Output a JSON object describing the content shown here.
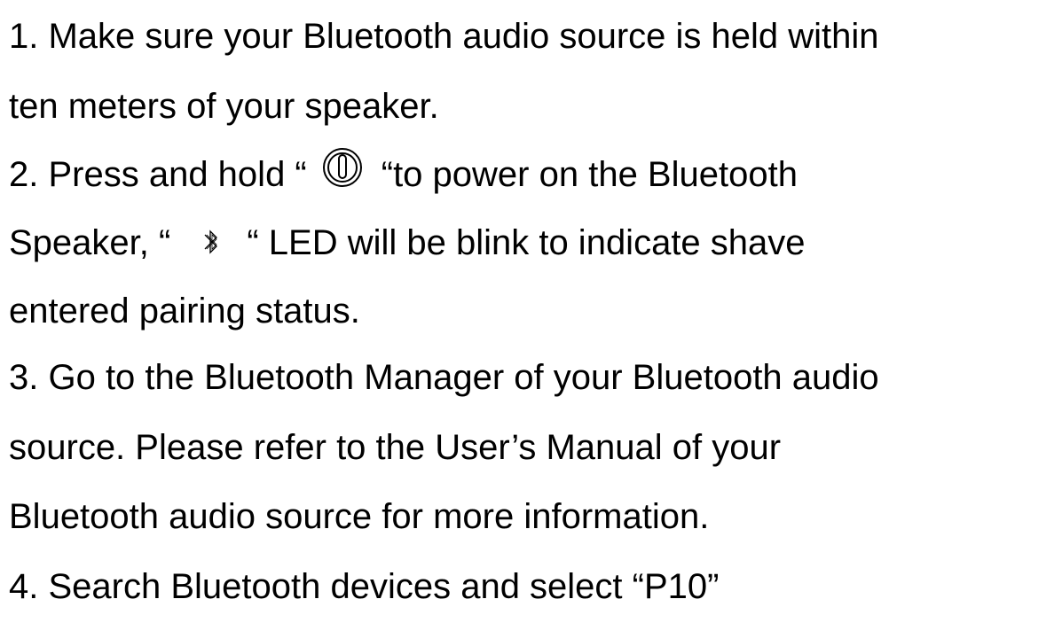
{
  "document": {
    "steps": [
      {
        "line1": "1. Make sure your Bluetooth audio source is held within",
        "line2": "ten meters of your speaker."
      },
      {
        "line1_before_icon": "2. Press and hold “",
        "line1_after_icon": "“to power on the Bluetooth",
        "line2_before_icon": "Speaker, “",
        "line2_after_icon": "“ LED will be blink to indicate shave",
        "line3": "entered pairing status.",
        "icons": [
          "power-icon",
          "bluetooth-icon"
        ]
      },
      {
        "line1": "3. Go to the Bluetooth Manager of your Bluetooth audio",
        "line2": "source. Please refer to the User’s Manual of your",
        "line3": "Bluetooth audio source for more information."
      },
      {
        "line1": "4. Search Bluetooth devices and select “P10”"
      }
    ]
  }
}
